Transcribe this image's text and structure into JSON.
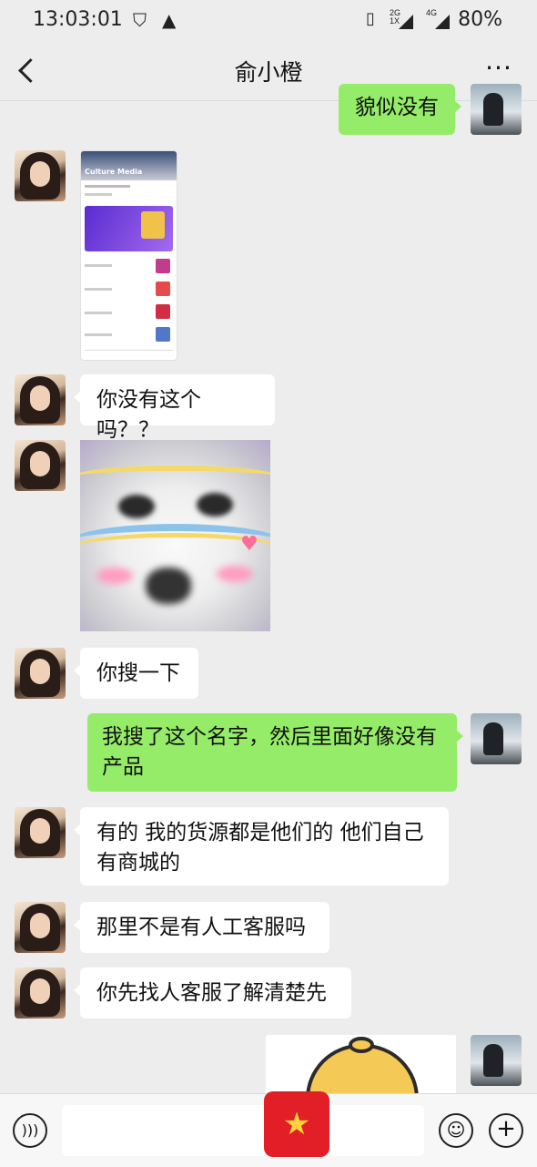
{
  "status_bar": {
    "time": "13:03:01",
    "network1": "2G\n1X",
    "network2": "4G",
    "battery": "80%"
  },
  "header": {
    "title": "俞小橙",
    "more": "···"
  },
  "messages": [
    {
      "side": "right",
      "type": "text",
      "text": "貌似没有"
    },
    {
      "side": "left",
      "type": "image",
      "image": "app-screenshot"
    },
    {
      "side": "left",
      "type": "text",
      "text": "你没有这个吗？？"
    },
    {
      "side": "left",
      "type": "sticker",
      "image": "blurry-face-sticker"
    },
    {
      "side": "left",
      "type": "text",
      "text": "你搜一下"
    },
    {
      "side": "right",
      "type": "text",
      "text": "我搜了这个名字，然后里面好像没有产品"
    },
    {
      "side": "left",
      "type": "text",
      "text": "有的 我的货源都是他们的 他们自己有商城的"
    },
    {
      "side": "left",
      "type": "text",
      "text": "那里不是有人工客服吗"
    },
    {
      "side": "left",
      "type": "text",
      "text": "你先找人客服了解清楚先"
    },
    {
      "side": "right",
      "type": "sticker",
      "image": "cartoon-hat-sticker"
    }
  ],
  "shot_text": {
    "hero": "Culture Media"
  },
  "bottom_bar": {
    "voice_icon": "voice-icon",
    "emoji_icon": "emoji-icon",
    "plus_icon": "plus-icon"
  },
  "colors": {
    "background": "#ededed",
    "bubble_right": "#95ec69",
    "bubble_left": "#ffffff"
  }
}
